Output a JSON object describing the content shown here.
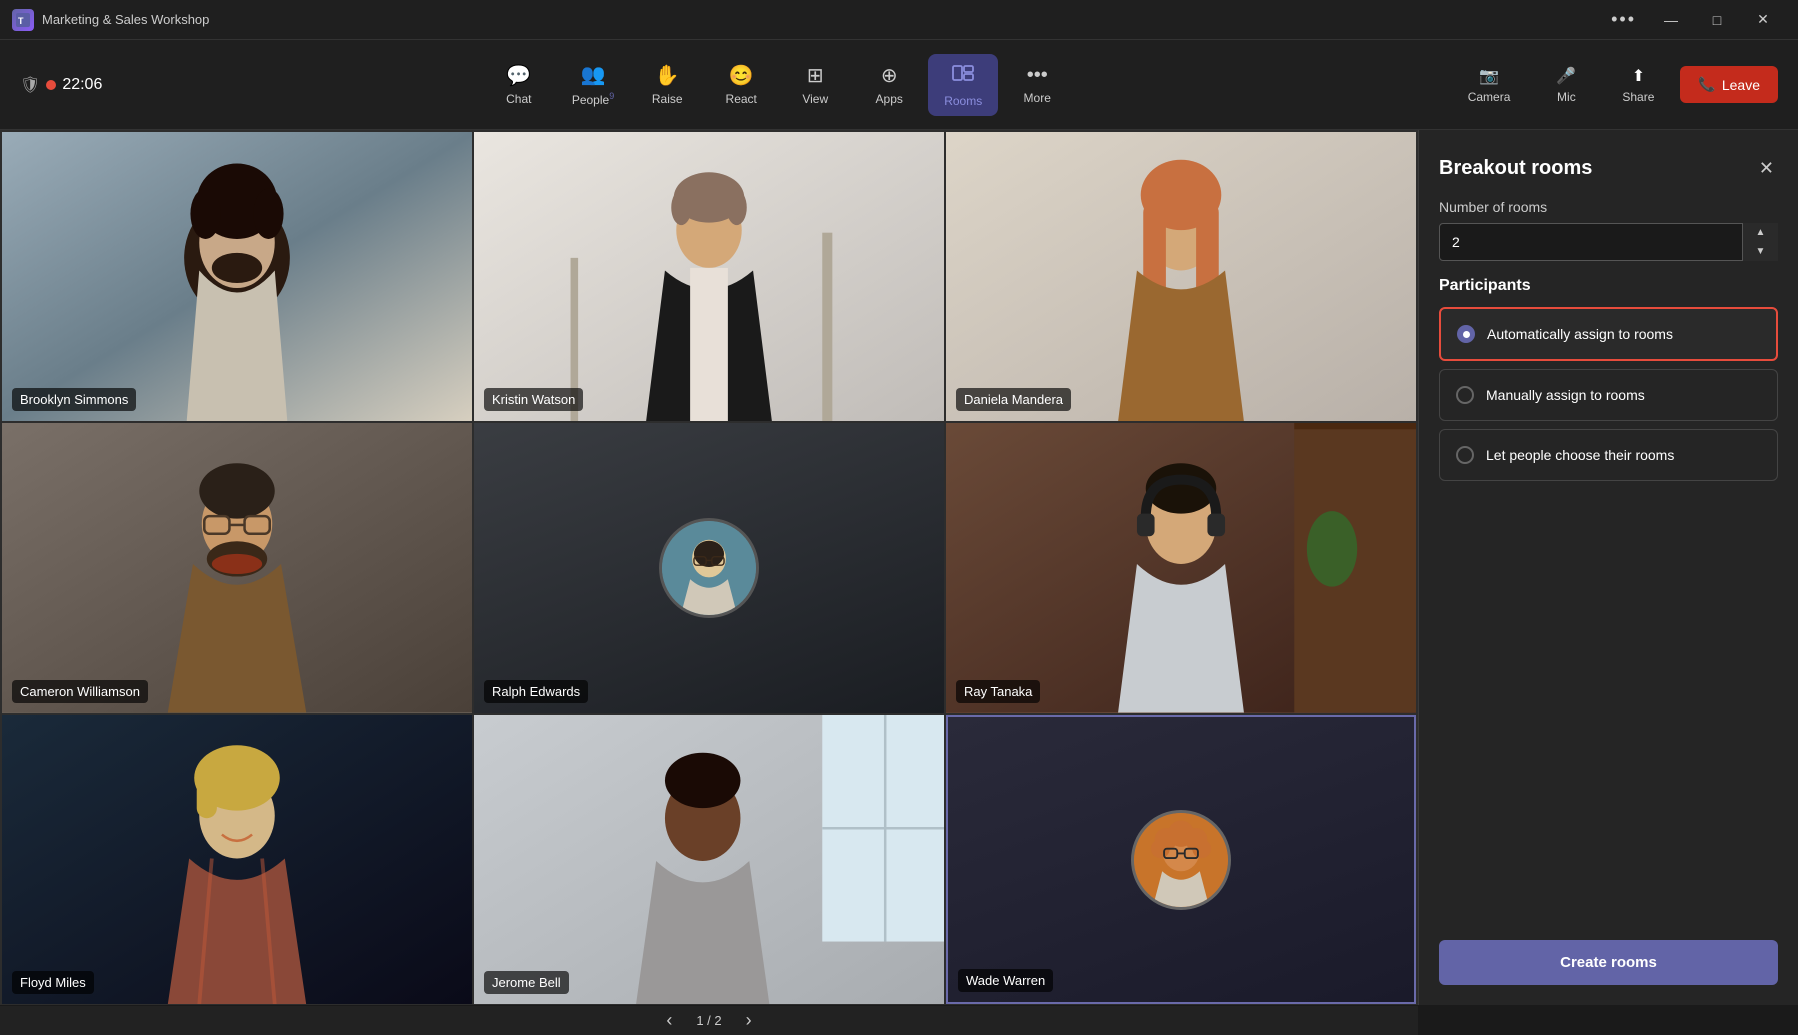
{
  "window": {
    "title": "Marketing & Sales Workshop",
    "dots_label": "•••",
    "minimize_label": "—",
    "maximize_label": "□",
    "close_label": "✕"
  },
  "toolbar": {
    "timer": "22:06",
    "nav_items": [
      {
        "id": "chat",
        "icon": "💬",
        "label": "Chat",
        "badge": ""
      },
      {
        "id": "people",
        "icon": "👥",
        "label": "People",
        "badge": "9"
      },
      {
        "id": "raise",
        "icon": "✋",
        "label": "Raise",
        "badge": ""
      },
      {
        "id": "react",
        "icon": "😊",
        "label": "React",
        "badge": ""
      },
      {
        "id": "view",
        "icon": "⊞",
        "label": "View",
        "badge": ""
      },
      {
        "id": "apps",
        "icon": "⊕",
        "label": "Apps",
        "badge": ""
      },
      {
        "id": "rooms",
        "icon": "⊡",
        "label": "Rooms",
        "badge": "",
        "active": true
      },
      {
        "id": "more",
        "icon": "•••",
        "label": "More",
        "badge": ""
      }
    ],
    "actions": [
      {
        "id": "camera",
        "icon": "📷",
        "label": "Camera"
      },
      {
        "id": "mic",
        "icon": "🎤",
        "label": "Mic"
      },
      {
        "id": "share",
        "icon": "⬆",
        "label": "Share"
      }
    ],
    "leave_label": "Leave"
  },
  "video_grid": {
    "participants": [
      {
        "id": "brooklyn",
        "name": "Brooklyn Simmons",
        "bg_class": "bg-brooklyn",
        "has_avatar": false
      },
      {
        "id": "kristin",
        "name": "Kristin Watson",
        "bg_class": "bg-kristin",
        "has_avatar": false
      },
      {
        "id": "daniela",
        "name": "Daniela Mandera",
        "bg_class": "bg-daniela",
        "has_avatar": false
      },
      {
        "id": "cameron",
        "name": "Cameron Williamson",
        "bg_class": "bg-cameron",
        "has_avatar": false
      },
      {
        "id": "ralph",
        "name": "Ralph Edwards",
        "bg_class": "bg-ralph",
        "has_avatar": true,
        "avatar_color": "#5a8a9a"
      },
      {
        "id": "ray",
        "name": "Ray Tanaka",
        "bg_class": "bg-ray",
        "has_avatar": false
      },
      {
        "id": "floyd",
        "name": "Floyd Miles",
        "bg_class": "bg-floyd",
        "has_avatar": false
      },
      {
        "id": "jerome",
        "name": "Jerome Bell",
        "bg_class": "bg-jerome",
        "has_avatar": false
      },
      {
        "id": "wade",
        "name": "Wade Warren",
        "bg_class": "bg-wade",
        "has_avatar": true,
        "avatar_color": "#c8742a"
      }
    ],
    "pagination": {
      "current": "1",
      "total": "2",
      "page_label": "1 / 2",
      "prev_label": "‹",
      "next_label": "›"
    }
  },
  "breakout_panel": {
    "title": "Breakout rooms",
    "close_label": "✕",
    "number_of_rooms_label": "Number of rooms",
    "rooms_value": "2",
    "participants_label": "Participants",
    "options": [
      {
        "id": "auto",
        "label": "Automatically assign to rooms",
        "selected": true
      },
      {
        "id": "manual",
        "label": "Manually assign to rooms",
        "selected": false
      },
      {
        "id": "choose",
        "label": "Let people choose their rooms",
        "selected": false
      }
    ],
    "create_rooms_label": "Create rooms"
  }
}
